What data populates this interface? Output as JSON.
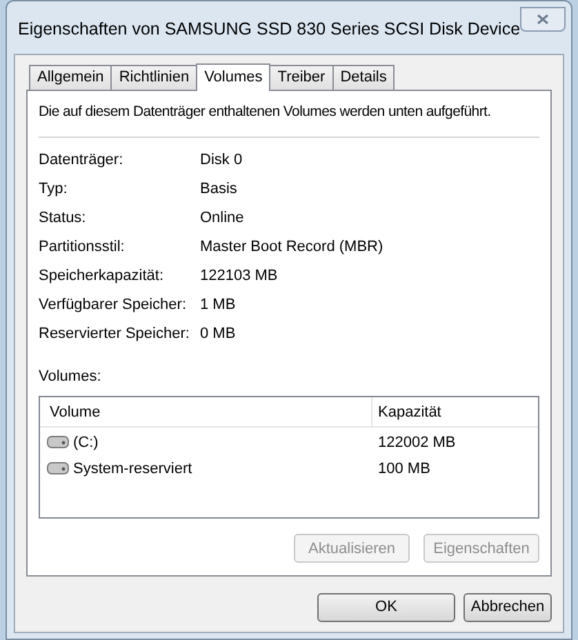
{
  "window": {
    "title": "Eigenschaften von SAMSUNG SSD 830 Series SCSI Disk Device"
  },
  "tabs": [
    {
      "label": "Allgemein",
      "selected": false
    },
    {
      "label": "Richtlinien",
      "selected": false
    },
    {
      "label": "Volumes",
      "selected": true
    },
    {
      "label": "Treiber",
      "selected": false
    },
    {
      "label": "Details",
      "selected": false
    }
  ],
  "description": "Die auf diesem Datenträger enthaltenen Volumes werden unten aufgeführt.",
  "properties": [
    {
      "label": "Datenträger:",
      "value": "Disk 0"
    },
    {
      "label": "Typ:",
      "value": "Basis"
    },
    {
      "label": "Status:",
      "value": "Online"
    },
    {
      "label": "Partitionsstil:",
      "value": "Master Boot Record (MBR)"
    },
    {
      "label": "Speicherkapazität:",
      "value": "122103 MB"
    },
    {
      "label": "Verfügbarer Speicher:",
      "value": "1 MB"
    },
    {
      "label": "Reservierter Speicher:",
      "value": "0 MB"
    }
  ],
  "volumes": {
    "label": "Volumes:",
    "columns": [
      "Volume",
      "Kapazität"
    ],
    "rows": [
      {
        "volume": "(C:)",
        "capacity": "122002 MB"
      },
      {
        "volume": "System-reserviert",
        "capacity": "100 MB"
      }
    ]
  },
  "panel_buttons": [
    {
      "label": "Aktualisieren",
      "disabled": true
    },
    {
      "label": "Eigenschaften",
      "disabled": true
    }
  ],
  "dialog_buttons": [
    {
      "label": "OK",
      "disabled": false
    },
    {
      "label": "Abbrechen",
      "disabled": false
    }
  ]
}
